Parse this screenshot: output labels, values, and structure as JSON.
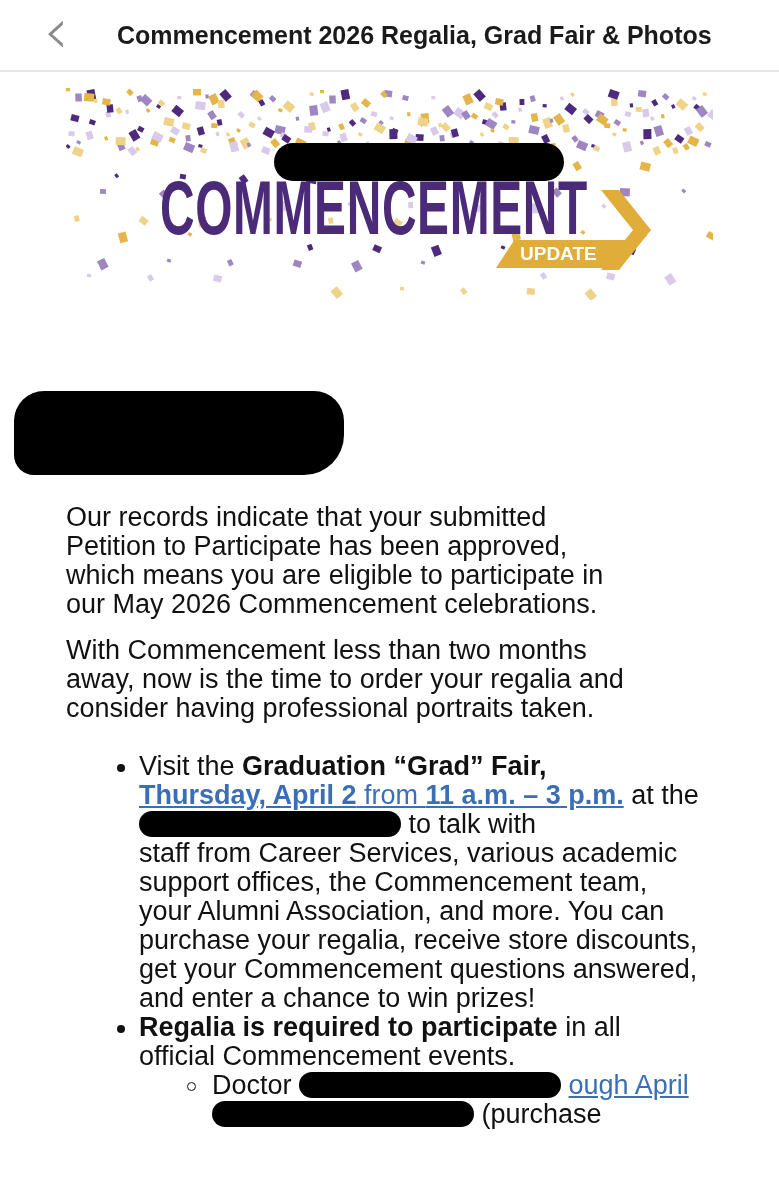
{
  "header": {
    "back_icon": "‹",
    "title": "Commencement 2026 Regalia, Grad Fair & Photos"
  },
  "banner": {
    "headline": "COMMENCEMENT",
    "badge": "UPDATE",
    "redacted": true
  },
  "sender_redacted": true,
  "paragraphs": [
    "Our records indicate that your submitted Petition to Participate has been approved, which means you are eligible to participate in our May 2026 Commencement celebrations.",
    "With Commencement less than two months away, now is the time to order your regalia and consider having professional portraits taken."
  ],
  "bullets": [
    {
      "segments": [
        {
          "kind": "text",
          "text": "Visit the **Graduation “Grad” Fair,**"
        },
        {
          "kind": "link",
          "text": "**Thursday, April 2** from **11 a.m. – 3 p.m.**"
        },
        {
          "kind": "text",
          "text": "at the"
        },
        {
          "kind": "redaction"
        },
        {
          "kind": "text",
          "text": "to talk with"
        },
        {
          "kind": "run",
          "text": "staff from Career Services, various academic support offices, the Commencement team, your Alumni Association, and more. You can purchase your regalia, receive store discounts, get your Commencement questions answered, and enter a chance to win prizes!"
        }
      ]
    },
    {
      "segments": [
        {
          "kind": "run",
          "text": "**Regalia is required to participate** in all official Commencement events."
        }
      ],
      "children": [
        {
          "segments": [
            {
              "kind": "text",
              "text": "Doctor"
            },
            {
              "kind": "redaction"
            },
            {
              "kind": "link",
              "text": "ough April"
            },
            {
              "kind": "redaction"
            },
            {
              "kind": "text",
              "text": "(purchase"
            }
          ]
        }
      ]
    }
  ]
}
